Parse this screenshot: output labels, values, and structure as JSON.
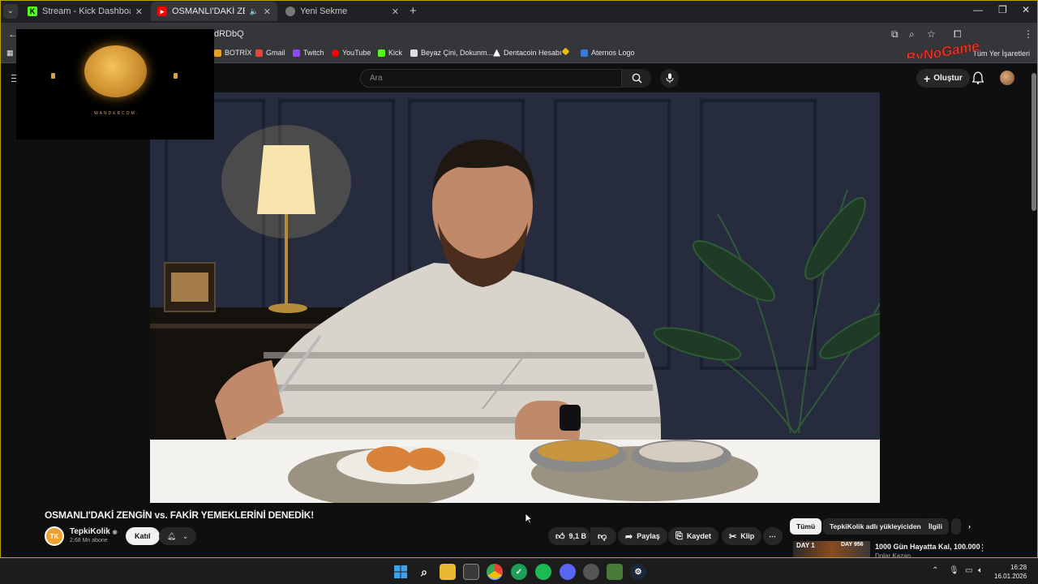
{
  "tabs": [
    {
      "label": "Stream - Kick Dashboard",
      "icon": "kick-icon",
      "active": false
    },
    {
      "label": "OSMANLI'DAKİ ZENGİN vs.",
      "icon": "youtube-icon",
      "active": true
    },
    {
      "label": "Yeni Sekme",
      "icon": "chrome-icon",
      "active": false
    }
  ],
  "url": "dRDbQ",
  "bookmarks": [
    {
      "label": "BOTRİX",
      "color": "#e8a020"
    },
    {
      "label": "Gmail",
      "color": "#ea4335"
    },
    {
      "label": "Twitch",
      "color": "#9146ff"
    },
    {
      "label": "YouTube",
      "color": "#ff0000"
    },
    {
      "label": "Kick",
      "color": "#53fc18"
    },
    {
      "label": "Beyaz Çini, Dokunm...",
      "color": "#dddddd"
    },
    {
      "label": "Dentacoin Hesabı",
      "color": "#ffffff"
    },
    {
      "label": "",
      "color": "#f0b90b"
    },
    {
      "label": "Aternos Logo",
      "color": "#3a7bd5"
    }
  ],
  "all_bookmarks": "Tüm Yer İşaretleri",
  "search_placeholder": "Ara",
  "create_label": "Oluştur",
  "overlay_text": ".WANDERCOM.",
  "logo_text": "ByNoGame",
  "video": {
    "title": "OSMANLI'DAKİ ZENGİN vs. FAKİR YEMEKLERİNİ DENEDİK!",
    "channel": "TepkiKolik",
    "channel_initials": "TK",
    "subscribers": "2,68 Mn abone",
    "join_label": "Katıl",
    "likes": "9,1 B",
    "share_label": "Paylaş",
    "save_label": "Kaydet",
    "clip_label": "Klip"
  },
  "chips": [
    "Tümü",
    "TepkiKolik adlı yükleyiciden",
    "İlgili"
  ],
  "recommendation": {
    "thumb_left": "DAY 1",
    "thumb_right": "DAY 956",
    "title": "1000 Gün Hayatta Kal, 100.000",
    "subtitle": "Dolar Kazan"
  },
  "clock": {
    "time": "16:28",
    "date": "16.01.2026"
  },
  "colors": {
    "accent": "#ff0000",
    "bg": "#0f0f0f",
    "chip": "#272727"
  }
}
